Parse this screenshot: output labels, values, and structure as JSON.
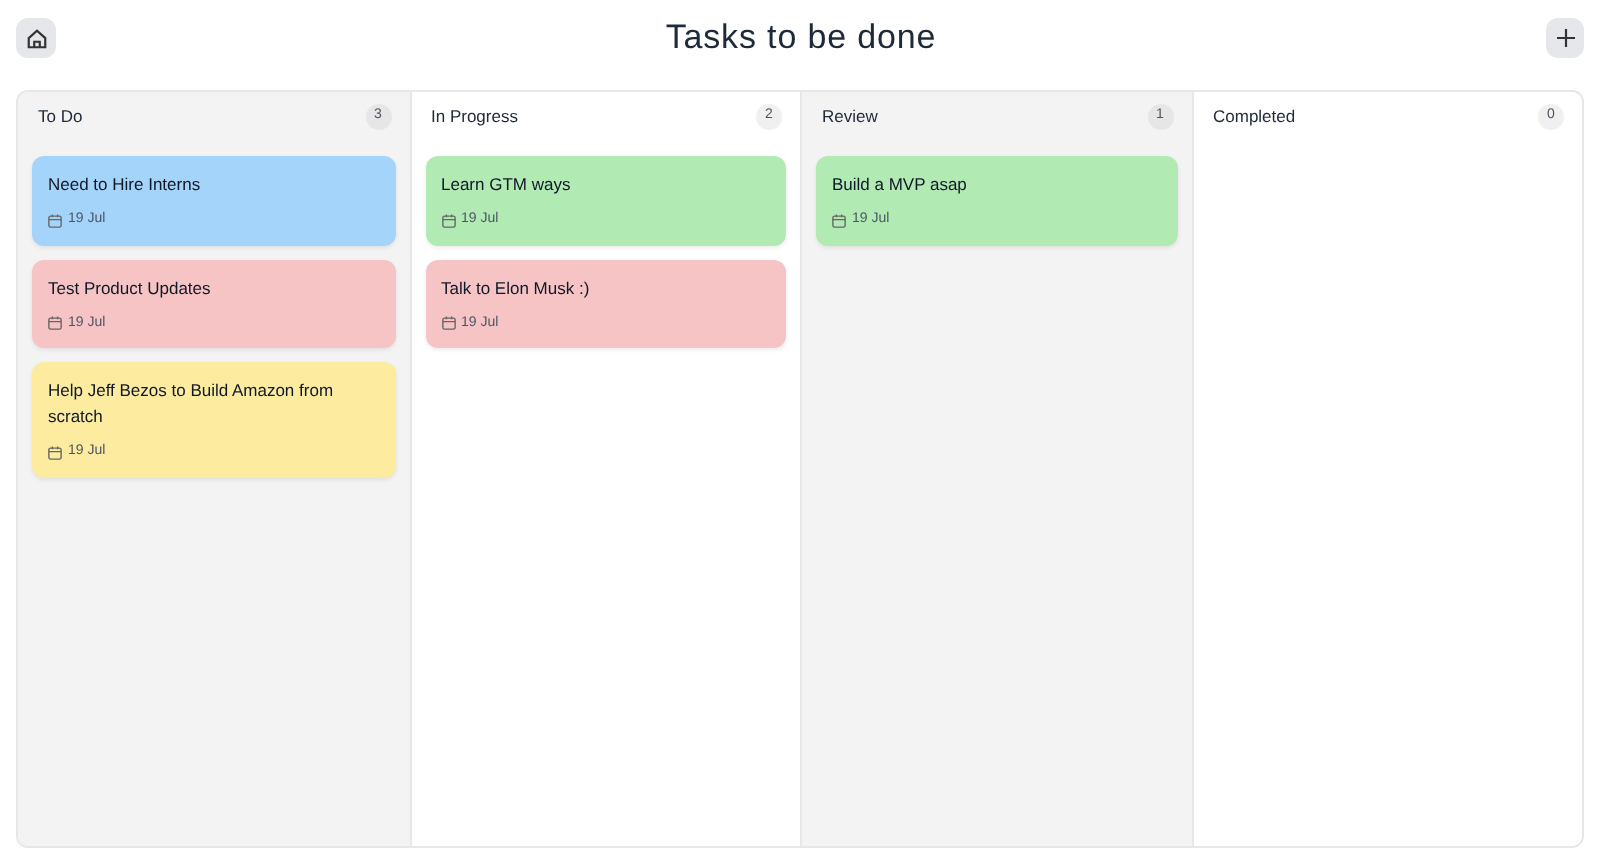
{
  "header": {
    "title": "Tasks to be done"
  },
  "columns": [
    {
      "title": "To Do",
      "count": "3",
      "cards": [
        {
          "title": "Need to Hire Interns",
          "date": "19 Jul",
          "color": "#a5d4fb"
        },
        {
          "title": "Test Product Updates",
          "date": "19 Jul",
          "color": "#f7c4c5"
        },
        {
          "title": "Help Jeff Bezos to Build Amazon from scratch",
          "date": "19 Jul",
          "color": "#fdec9f"
        }
      ]
    },
    {
      "title": "In Progress",
      "count": "2",
      "cards": [
        {
          "title": "Learn GTM ways",
          "date": "19 Jul",
          "color": "#b1ebb3"
        },
        {
          "title": "Talk to Elon Musk :)",
          "date": "19 Jul",
          "color": "#f7c4c5"
        }
      ]
    },
    {
      "title": "Review",
      "count": "1",
      "cards": [
        {
          "title": "Build a MVP asap",
          "date": "19 Jul",
          "color": "#b1ebb3"
        }
      ]
    },
    {
      "title": "Completed",
      "count": "0"
    }
  ]
}
